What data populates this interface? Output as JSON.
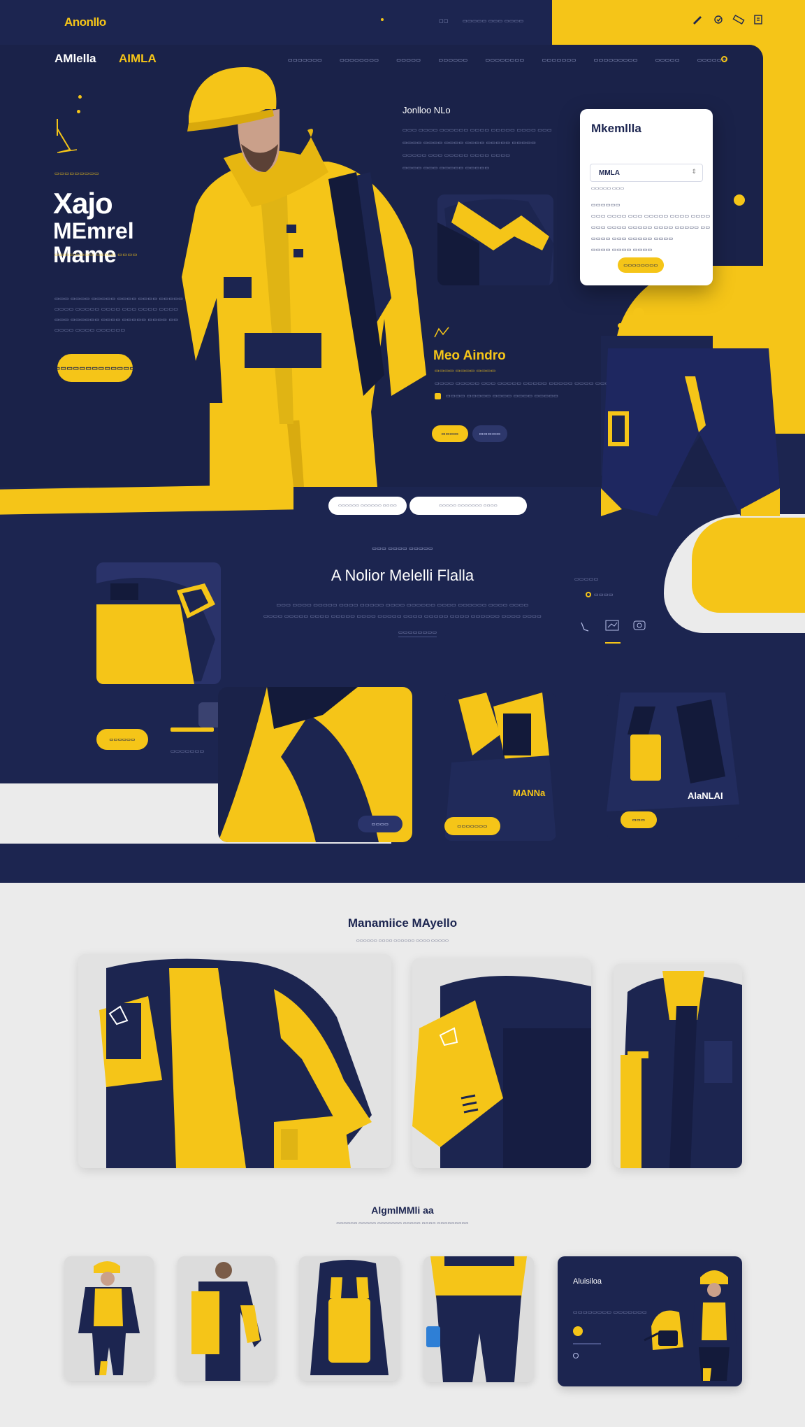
{
  "colors": {
    "navy": "#1c2550",
    "navy_dark": "#161d42",
    "yellow": "#f5c518",
    "light_bg": "#ebebeb",
    "white": "#ffffff"
  },
  "topbar": {
    "logo": "Anonllo",
    "links": [
      "▢▢",
      "▭▭▭▭▭ ▭▭▭ ▭▭▭▭"
    ],
    "icons": [
      "pencil-icon",
      "badge-icon",
      "ruler-icon",
      "bookmark-icon"
    ]
  },
  "nav": {
    "brand_left": "AMlella",
    "brand_right": "AIMLA",
    "links": [
      "▭▭▭▭▭▭▭",
      "▭▭▭▭▭▭▭▭",
      "▭▭▭▭▭",
      "▭▭▭▭▭▭",
      "▭▭▭▭▭▭▭▭",
      "▭▭▭▭▭▭▭",
      "▭▭▭▭▭▭▭▭▭",
      "▭▭▭▭▭",
      "▭▭▭▭▭▭"
    ]
  },
  "hero": {
    "eyebrow": "▭▭▭▭▭▭▭▭▭",
    "title_1": "Xajo",
    "title_2": "MEmrel",
    "title_3": "Mame",
    "subtitle": "▭▭▭▭▭▭▭▭ ▭▭▭▭ ▭▭▭▭",
    "paragraph": [
      "▭▭▭ ▭▭▭▭ ▭▭▭▭▭ ▭▭▭▭ ▭▭▭▭ ▭▭▭▭▭",
      "▭▭▭▭ ▭▭▭▭▭ ▭▭▭▭ ▭▭▭ ▭▭▭▭ ▭▭▭▭",
      "▭▭▭ ▭▭▭▭▭▭ ▭▭▭▭ ▭▭▭▭▭ ▭▭▭▭ ▭▭",
      "▭▭▭▭ ▭▭▭▭ ▭▭▭▭▭▭"
    ],
    "cta": "▭▭▭▭▭▭▭▭▭▭▭▭▭"
  },
  "info_block": {
    "title": "Jonlloo NLo",
    "lines": [
      "▭▭▭ ▭▭▭▭ ▭▭▭▭▭▭ ▭▭▭▭ ▭▭▭▭▭ ▭▭▭▭ ▭▭▭",
      "▭▭▭▭ ▭▭▭▭ ▭▭▭▭ ▭▭▭▭ ▭▭▭▭▭ ▭▭▭▭▭",
      "▭▭▭▭▭ ▭▭▭ ▭▭▭▭▭ ▭▭▭▭ ▭▭▭▭",
      "▭▭▭▭ ▭▭▭ ▭▭▭▭▭   ▭▭▭▭▭"
    ]
  },
  "card": {
    "title": "Mkemllla",
    "select_value": "MMLA",
    "label": "▭▭▭▭▭ ▭▭▭",
    "rows": [
      "▭▭▭▭▭▭",
      "▭▭▭ ▭▭▭▭ ▭▭▭ ▭▭▭▭▭ ▭▭▭▭ ▭▭▭▭",
      "▭▭▭ ▭▭▭▭ ▭▭▭▭▭ ▭▭▭▭ ▭▭▭▭▭ ▭▭",
      "▭▭▭▭ ▭▭▭ ▭▭▭▭▭ ▭▭▭▭",
      "▭▭▭▭ ▭▭▭▭ ▭▭▭▭"
    ],
    "button": "▭▭▭▭▭▭▭▭"
  },
  "feature": {
    "title": "Meo Aindro",
    "sub": "▭▭▭▭ ▭▭▭▭ ▭▭▭▭",
    "line_1": "▭▭▭▭ ▭▭▭▭▭ ▭▭▭ ▭▭▭▭▭ ▭▭▭▭▭ ▭▭▭▭▭ ▭▭▭▭ ▭▭▭▭▭",
    "line_2": "▭▭▭▭ ▭▭▭▭▭ ▭▭▭▭ ▭▭▭▭ ▭▭▭▭▭",
    "btn_primary": "▭▭▭▭",
    "btn_secondary": "▭▭▭▭▭"
  },
  "divider_tabs": [
    "▭▭▭▭▭▭   ▭▭▭▭▭▭   ▭▭▭▭",
    "▭▭▭▭▭   ▭▭▭▭▭▭▭   ▭▭▭▭"
  ],
  "section2": {
    "eyebrow": "▭▭▭ ▭▭▭▭ ▭▭▭▭▭",
    "title": "A Nolior Melelli Flalla",
    "lines": [
      "▭▭▭ ▭▭▭▭ ▭▭▭▭▭ ▭▭▭▭ ▭▭▭▭▭ ▭▭▭▭ ▭▭▭▭▭▭ ▭▭▭▭ ▭▭▭▭▭▭ ▭▭▭▭ ▭▭▭▭",
      "▭▭▭▭ ▭▭▭▭▭ ▭▭▭▭ ▭▭▭▭▭ ▭▭▭▭ ▭▭▭▭▭ ▭▭▭▭ ▭▭▭▭▭ ▭▭▭▭ ▭▭▭▭▭▭ ▭▭▭▭ ▭▭▭▭"
    ],
    "link": "▭▭▭▭▭▭▭▭",
    "side_label": "▭▭▭▭▭",
    "side_item": "▭▭▭▭",
    "left_btn": "▭▭▭▭▭▭",
    "left_caption": "▭▭▭▭▭▭▭",
    "thumb_btn": "▭▭▭▭",
    "brand_tag_1": "MANNa",
    "brand_tag_2": "AlaNLAI",
    "thumb_btn_2": "▭▭▭▭▭▭▭",
    "thumb_btn_3": "▭▭▭"
  },
  "gallery": {
    "title": "Manamiice MAyello",
    "subtitle": "▭▭▭▭▭▭ ▭▭▭▭ ▭▭▭▭▭▭ ▭▭▭▭ ▭▭▭▭▭"
  },
  "products": {
    "title": "AlgmlMMli aa",
    "subtitle": "▭▭▭▭▭▭ ▭▭▭▭▭ ▭▭▭▭▭▭▭ ▭▭▭▭▭ ▭▭▭▭ ▭▭▭▭▭▭▭▭▭",
    "promo_title": "Aluisiloa",
    "promo_line": "▭▭▭▭▭▭▭▭ ▭▭▭▭▭▭▭"
  }
}
